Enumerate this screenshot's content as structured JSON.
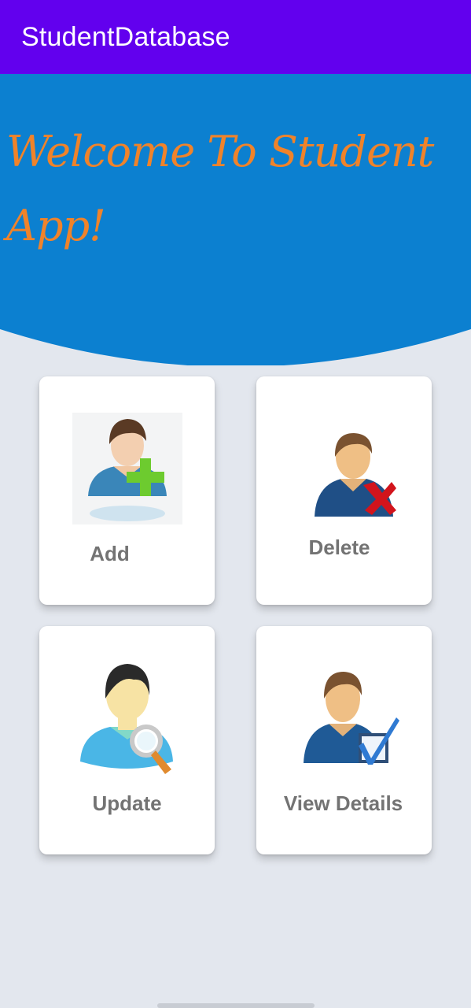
{
  "app_bar": {
    "title": "StudentDatabase",
    "color": "#6200ee"
  },
  "hero": {
    "welcome_text": "Welcome To Student App!",
    "background_color": "#0c80d0",
    "text_color": "#f0832a"
  },
  "menu": {
    "add": {
      "label": "Add",
      "icon": "add-student-icon"
    },
    "delete": {
      "label": "Delete",
      "icon": "delete-student-icon"
    },
    "update": {
      "label": "Update",
      "icon": "update-student-icon"
    },
    "view_details": {
      "label": "View Details",
      "icon": "view-details-icon"
    }
  },
  "colors": {
    "page_background": "#e3e7ee",
    "card_background": "#ffffff",
    "label_color": "#737373"
  }
}
